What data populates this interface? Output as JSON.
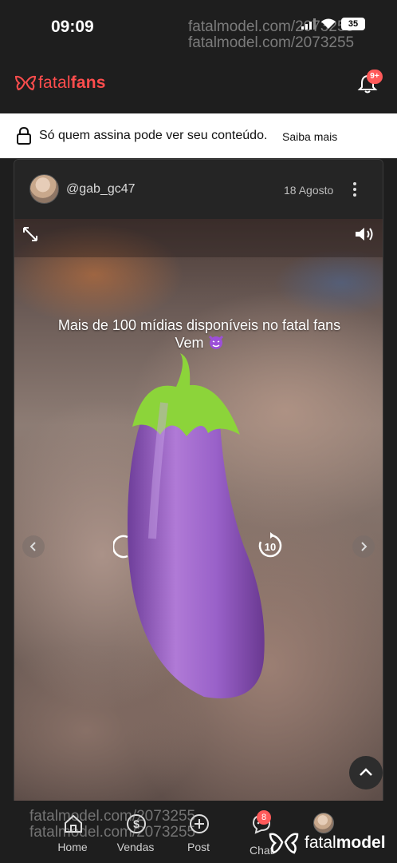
{
  "status_bar": {
    "time": "09:09",
    "battery": "35"
  },
  "watermark": {
    "line1": "fatalmodel.com/2073255",
    "line2": "fatalmodel.com/2073255"
  },
  "header": {
    "brand_light": "fatal",
    "brand_bold": "fans",
    "notifications_badge": "9+",
    "brand_color": "#ff4d4d"
  },
  "notice": {
    "text": "Só quem assina pode ver seu conteúdo.",
    "link": "Saiba mais"
  },
  "post": {
    "username": "@gab_gc47",
    "date": "18 Agosto",
    "caption_line1": "Mais de 100 mídias disponíveis no fatal fans",
    "caption_line2": "Vem",
    "forward_seconds": "10"
  },
  "bottom_nav": {
    "items": [
      {
        "label": "Home",
        "icon": "home-icon"
      },
      {
        "label": "Vendas",
        "icon": "dollar-icon"
      },
      {
        "label": "Post",
        "icon": "add-post-icon"
      },
      {
        "label": "Chat",
        "icon": "chat-icon"
      }
    ],
    "chat_badge": "8"
  },
  "footer_logo": {
    "light": "fatal",
    "bold": "model"
  }
}
